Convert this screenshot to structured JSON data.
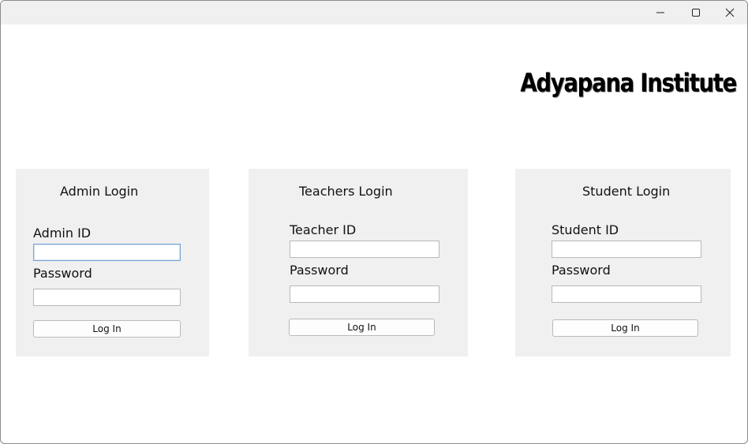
{
  "window": {
    "controls": {
      "minimize_icon": "minimize-icon",
      "maximize_icon": "maximize-icon",
      "close_icon": "close-icon"
    }
  },
  "app": {
    "title": "Adyapana Institute"
  },
  "panels": {
    "admin": {
      "heading": "Admin Login",
      "id_label": "Admin ID",
      "id_value": "",
      "password_label": "Password",
      "password_value": "",
      "button_label": "Log In"
    },
    "teacher": {
      "heading": "Teachers Login",
      "id_label": "Teacher ID",
      "id_value": "",
      "password_label": "Password",
      "password_value": "",
      "button_label": "Log In"
    },
    "student": {
      "heading": "Student Login",
      "id_label": "Student ID",
      "id_value": "",
      "password_label": "Password",
      "password_value": "",
      "button_label": "Log In"
    }
  },
  "colors": {
    "panel_background": "#f0f0f0",
    "focus_border": "#7aa7d6"
  }
}
